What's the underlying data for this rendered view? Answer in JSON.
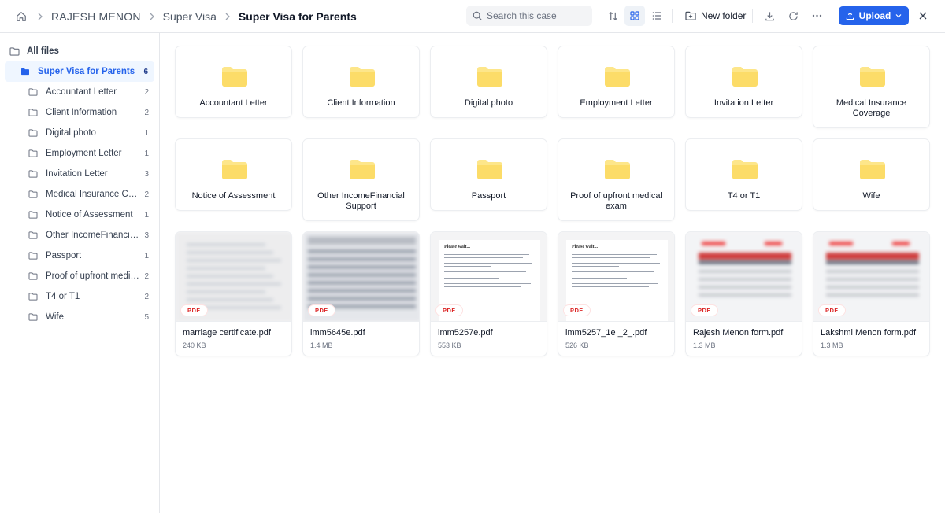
{
  "breadcrumb": [
    "RAJESH MENON",
    "Super Visa",
    "Super Visa for Parents"
  ],
  "search": {
    "placeholder": "Search this case"
  },
  "toolbar": {
    "new_folder": "New folder",
    "upload": "Upload"
  },
  "sidebar": {
    "root": "All files",
    "selected": {
      "label": "Super Visa for Parents",
      "count": "6"
    },
    "items": [
      {
        "label": "Accountant Letter",
        "count": "2"
      },
      {
        "label": "Client Information",
        "count": "2"
      },
      {
        "label": "Digital photo",
        "count": "1"
      },
      {
        "label": "Employment Letter",
        "count": "1"
      },
      {
        "label": "Invitation Letter",
        "count": "3"
      },
      {
        "label": "Medical Insurance Coverage",
        "count": "2"
      },
      {
        "label": "Notice of Assessment",
        "count": "1"
      },
      {
        "label": "Other IncomeFinancial Support",
        "count": "3"
      },
      {
        "label": "Passport",
        "count": "1"
      },
      {
        "label": "Proof of upfront medical exam",
        "count": "2"
      },
      {
        "label": "T4 or T1",
        "count": "2"
      },
      {
        "label": "Wife",
        "count": "5"
      }
    ]
  },
  "folders": [
    "Accountant Letter",
    "Client Information",
    "Digital photo",
    "Employment Letter",
    "Invitation Letter",
    "Medical Insurance Coverage",
    "Notice of Assessment",
    "Other IncomeFinancial Support",
    "Passport",
    "Proof of upfront medical exam",
    "T4 or T1",
    "Wife"
  ],
  "files": [
    {
      "name": "marriage certificate.pdf",
      "size": "240 KB",
      "badge": "PDF",
      "thumb": "blur-gray"
    },
    {
      "name": "imm5645e.pdf",
      "size": "1.4 MB",
      "badge": "PDF",
      "thumb": "blur-form"
    },
    {
      "name": "imm5257e.pdf",
      "size": "553 KB",
      "badge": "PDF",
      "thumb": "please-wait",
      "thumb_heading": "Please wait..."
    },
    {
      "name": "imm5257_1e _2_.pdf",
      "size": "526 KB",
      "badge": "PDF",
      "thumb": "please-wait",
      "thumb_heading": "Please wait..."
    },
    {
      "name": "Rajesh Menon form.pdf",
      "size": "1.3 MB",
      "badge": "PDF",
      "thumb": "blur-redbar"
    },
    {
      "name": "Lakshmi Menon form.pdf",
      "size": "1.3 MB",
      "badge": "PDF",
      "thumb": "blur-redbar"
    }
  ],
  "colors": {
    "accent": "#2563eb",
    "folder": "#fde68a",
    "pdf_badge": "#dc2626"
  }
}
